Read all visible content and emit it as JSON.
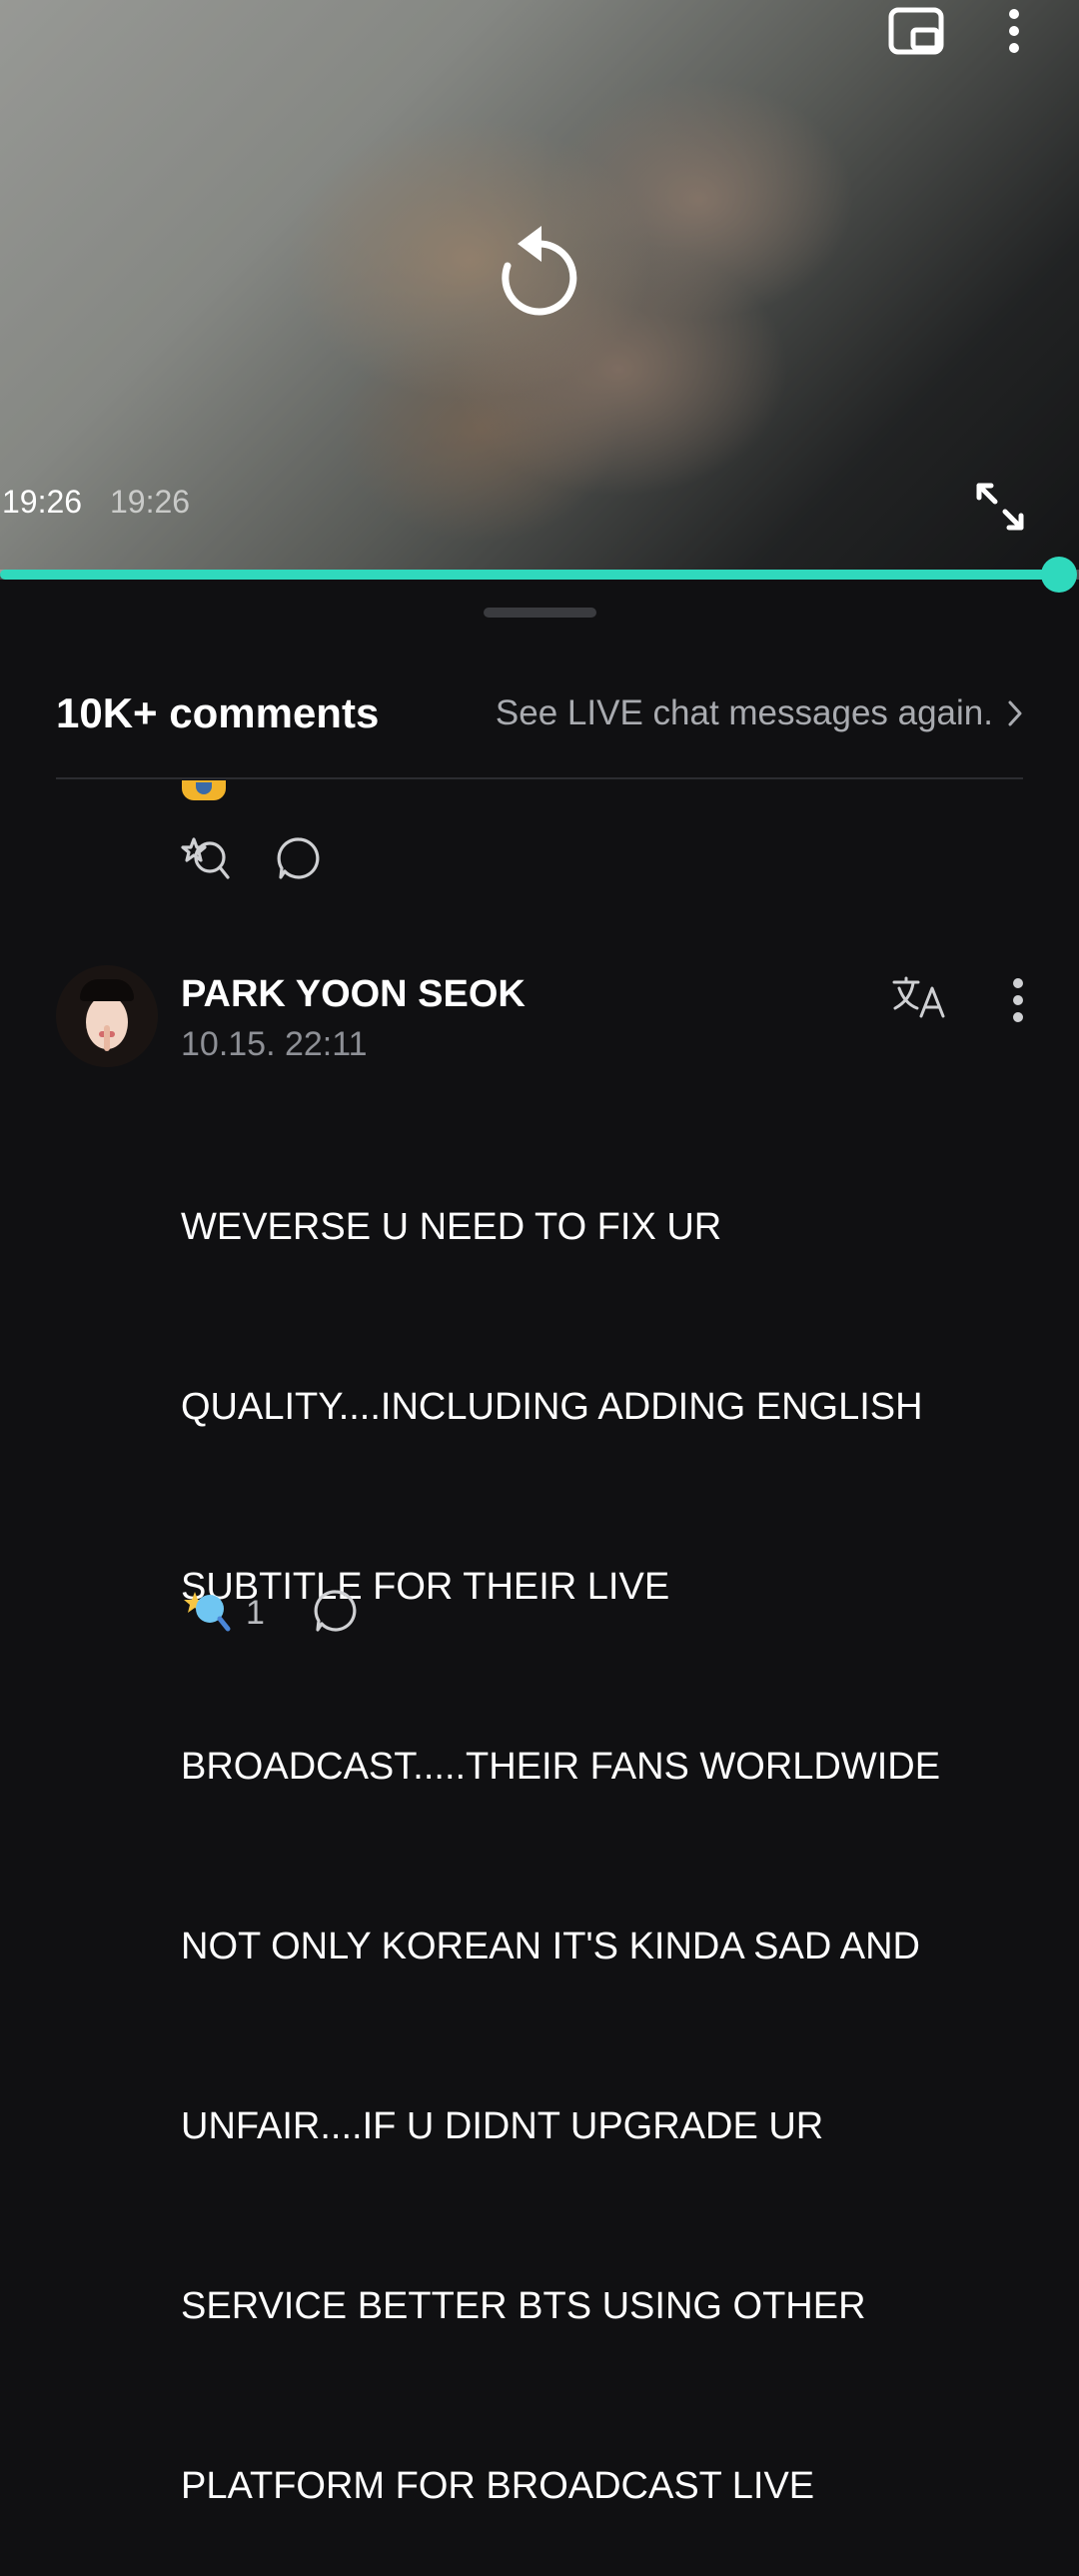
{
  "player": {
    "current_time": "19:26",
    "total_time": "19:26",
    "progress": 1.0,
    "accent_color": "#2fd9bd",
    "icons": {
      "pip": "picture-in-picture-icon",
      "more": "more-vertical-icon",
      "replay": "replay-icon",
      "fullscreen": "fullscreen-icon"
    }
  },
  "comments_header": {
    "title": "10K+ comments",
    "live_link": "See LIVE chat messages again."
  },
  "previous_comment": {
    "icons": [
      "reaction-add-icon",
      "reply-icon"
    ]
  },
  "comment": {
    "author": "PARK YOON SEOK",
    "time": "10.15. 22:11",
    "lines": [
      "WEVERSE U NEED TO FIX UR",
      "QUALITY....INCLUDING ADDING ENGLISH",
      "SUBTITLE FOR THEIR LIVE",
      "BROADCAST.....THEIR FANS WORLDWIDE",
      "NOT ONLY KOREAN IT'S KINDA SAD AND",
      "UNFAIR....IF U DIDNT UPGRADE UR",
      "SERVICE BETTER BTS USING OTHER",
      "PLATFORM FOR BROADCAST LIVE"
    ],
    "like_count": "1",
    "icons": [
      "translate-icon",
      "more-vertical-icon",
      "reaction-icon",
      "reply-icon"
    ]
  }
}
